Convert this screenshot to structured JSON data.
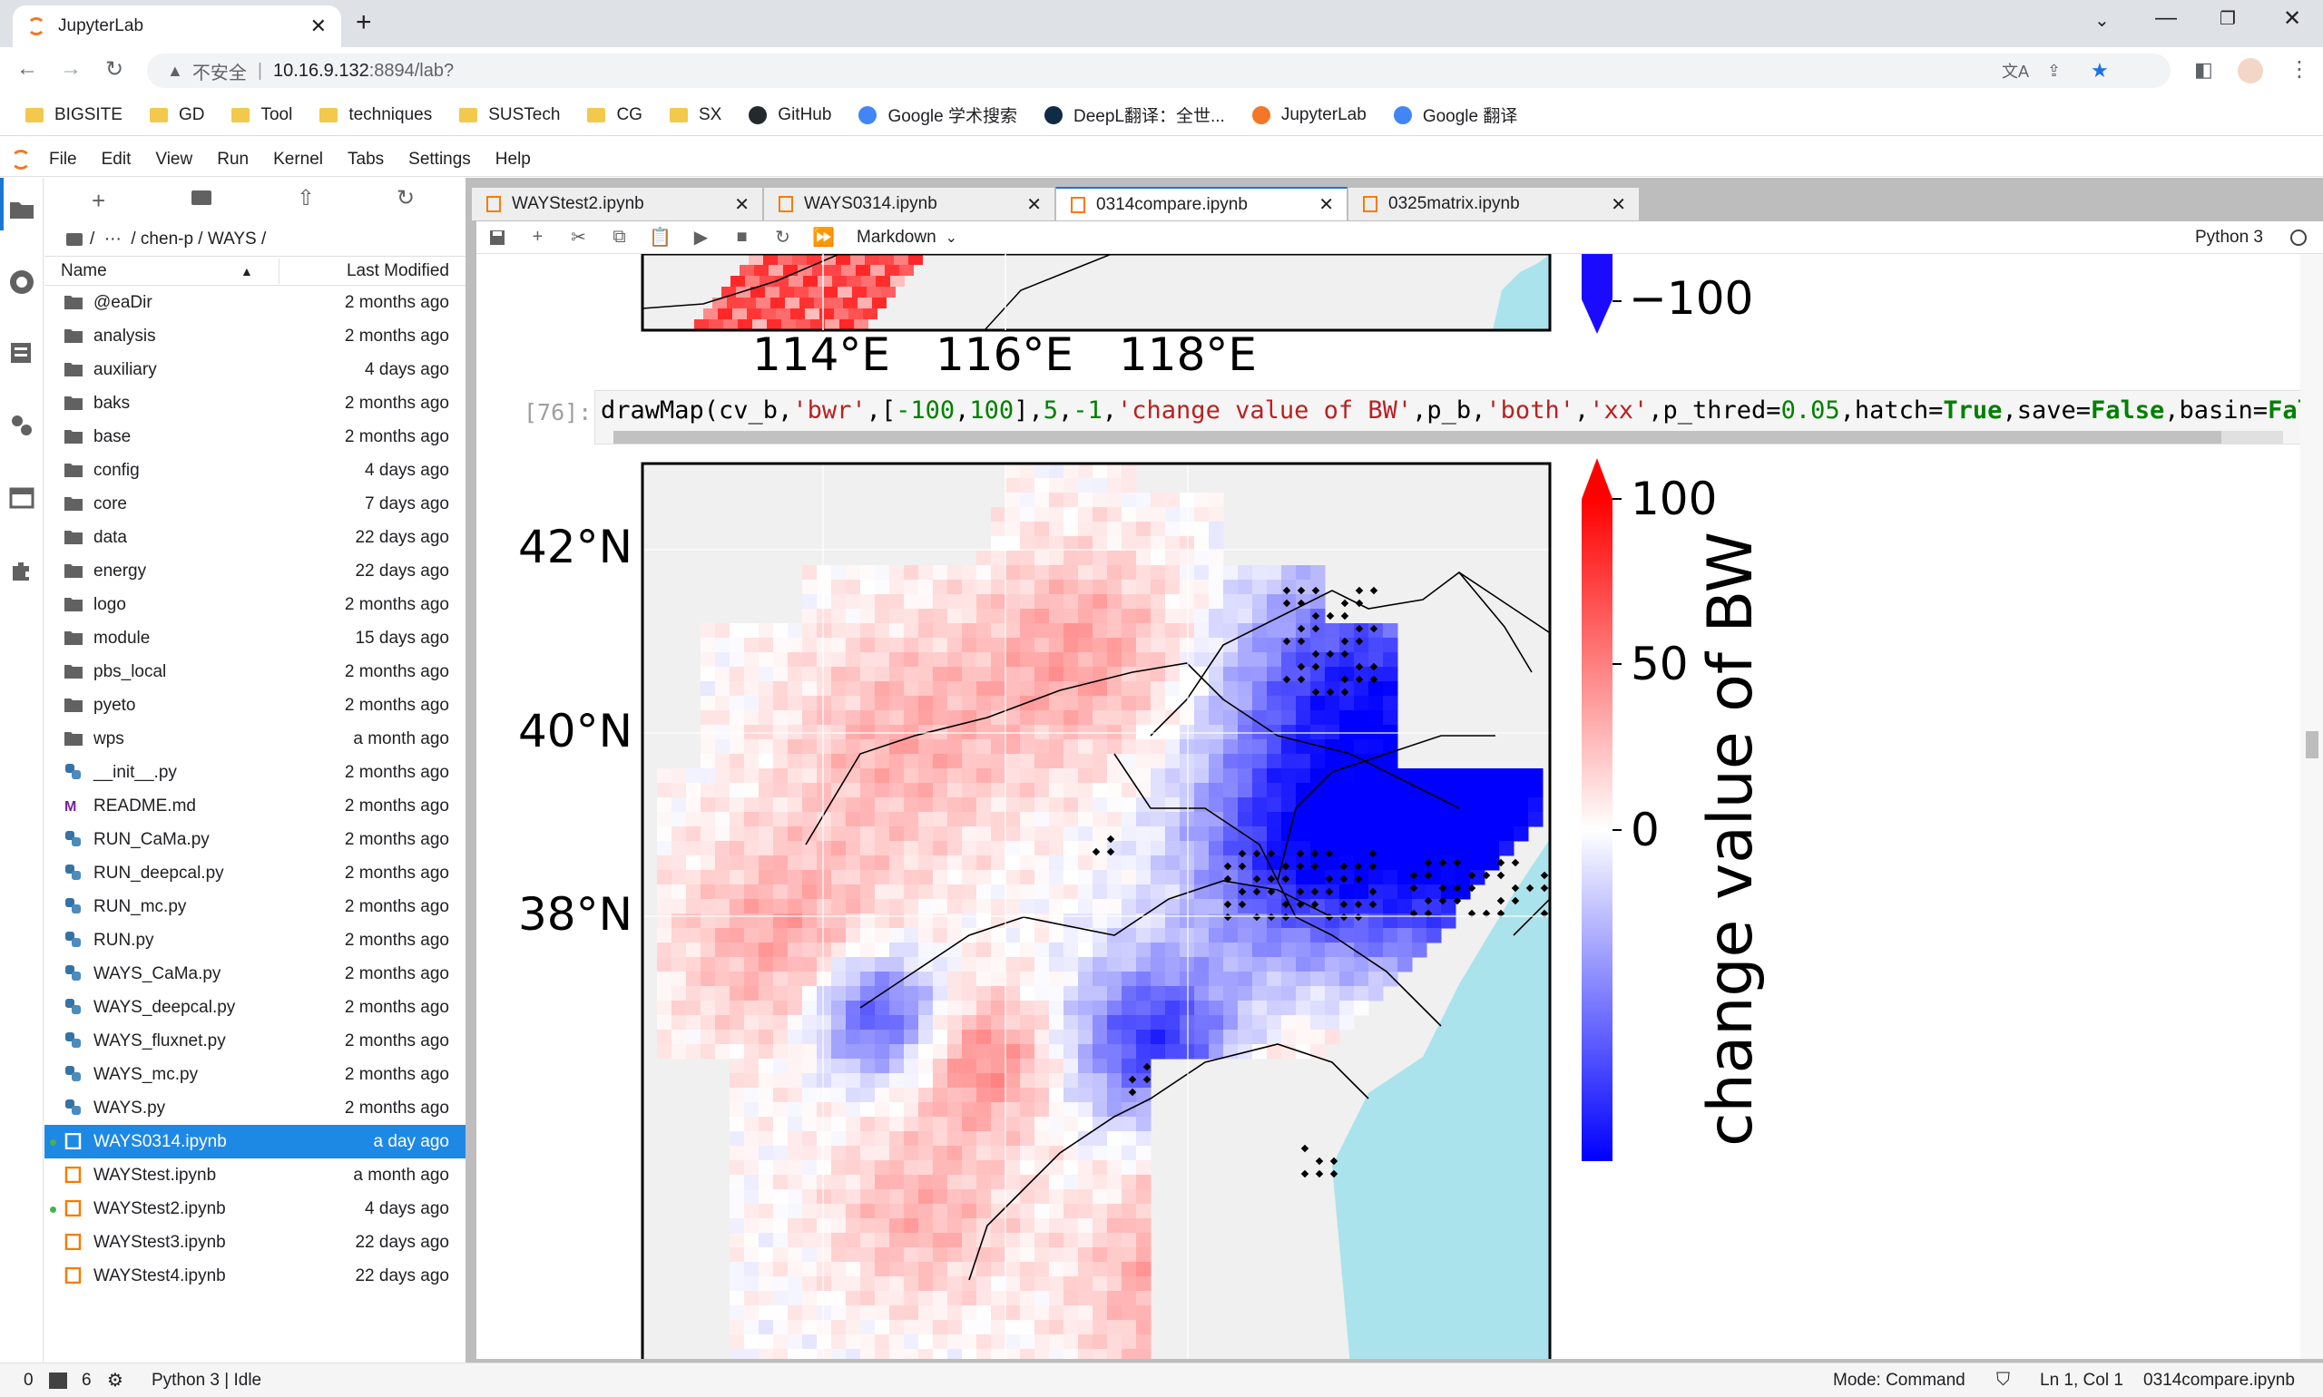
{
  "browser": {
    "tab_title": "JupyterLab",
    "security_label": "不安全",
    "url_host": "10.16.9.132",
    "url_path": ":8894/lab?",
    "bookmarks": [
      {
        "label": "BIGSITE",
        "icon": "folder"
      },
      {
        "label": "GD",
        "icon": "folder"
      },
      {
        "label": "Tool",
        "icon": "folder"
      },
      {
        "label": "techniques",
        "icon": "folder"
      },
      {
        "label": "SUSTech",
        "icon": "folder"
      },
      {
        "label": "CG",
        "icon": "folder"
      },
      {
        "label": "SX",
        "icon": "folder"
      },
      {
        "label": "GitHub",
        "icon": "github"
      },
      {
        "label": "Google 学术搜索",
        "icon": "scholar"
      },
      {
        "label": "DeepL翻译：全世...",
        "icon": "deepl"
      },
      {
        "label": "JupyterLab",
        "icon": "jupyter"
      },
      {
        "label": "Google 翻译",
        "icon": "translate"
      }
    ]
  },
  "menu": [
    "File",
    "Edit",
    "View",
    "Run",
    "Kernel",
    "Tabs",
    "Settings",
    "Help"
  ],
  "filebrowser": {
    "breadcrumb": "/  ···  / chen-p / WAYS /",
    "col_name": "Name",
    "col_modified": "Last Modified",
    "files": [
      {
        "name": "@eaDir",
        "modified": "2 months ago",
        "type": "folder"
      },
      {
        "name": "analysis",
        "modified": "2 months ago",
        "type": "folder"
      },
      {
        "name": "auxiliary",
        "modified": "4 days ago",
        "type": "folder"
      },
      {
        "name": "baks",
        "modified": "2 months ago",
        "type": "folder"
      },
      {
        "name": "base",
        "modified": "2 months ago",
        "type": "folder"
      },
      {
        "name": "config",
        "modified": "4 days ago",
        "type": "folder"
      },
      {
        "name": "core",
        "modified": "7 days ago",
        "type": "folder"
      },
      {
        "name": "data",
        "modified": "22 days ago",
        "type": "folder"
      },
      {
        "name": "energy",
        "modified": "22 days ago",
        "type": "folder"
      },
      {
        "name": "logo",
        "modified": "2 months ago",
        "type": "folder"
      },
      {
        "name": "module",
        "modified": "15 days ago",
        "type": "folder"
      },
      {
        "name": "pbs_local",
        "modified": "2 months ago",
        "type": "folder"
      },
      {
        "name": "pyeto",
        "modified": "2 months ago",
        "type": "folder"
      },
      {
        "name": "wps",
        "modified": "a month ago",
        "type": "folder"
      },
      {
        "name": "__init__.py",
        "modified": "2 months ago",
        "type": "python"
      },
      {
        "name": "README.md",
        "modified": "2 months ago",
        "type": "markdown"
      },
      {
        "name": "RUN_CaMa.py",
        "modified": "2 months ago",
        "type": "python"
      },
      {
        "name": "RUN_deepcal.py",
        "modified": "2 months ago",
        "type": "python"
      },
      {
        "name": "RUN_mc.py",
        "modified": "2 months ago",
        "type": "python"
      },
      {
        "name": "RUN.py",
        "modified": "2 months ago",
        "type": "python"
      },
      {
        "name": "WAYS_CaMa.py",
        "modified": "2 months ago",
        "type": "python"
      },
      {
        "name": "WAYS_deepcal.py",
        "modified": "2 months ago",
        "type": "python"
      },
      {
        "name": "WAYS_fluxnet.py",
        "modified": "2 months ago",
        "type": "python"
      },
      {
        "name": "WAYS_mc.py",
        "modified": "2 months ago",
        "type": "python"
      },
      {
        "name": "WAYS.py",
        "modified": "2 months ago",
        "type": "python"
      },
      {
        "name": "WAYS0314.ipynb",
        "modified": "a day ago",
        "type": "notebook",
        "selected": true,
        "running": true
      },
      {
        "name": "WAYStest.ipynb",
        "modified": "a month ago",
        "type": "notebook"
      },
      {
        "name": "WAYStest2.ipynb",
        "modified": "4 days ago",
        "type": "notebook",
        "running": true
      },
      {
        "name": "WAYStest3.ipynb",
        "modified": "22 days ago",
        "type": "notebook"
      },
      {
        "name": "WAYStest4.ipynb",
        "modified": "22 days ago",
        "type": "notebook"
      }
    ]
  },
  "doc_tabs": [
    {
      "label": "WAYStest2.ipynb",
      "active": false
    },
    {
      "label": "WAYS0314.ipynb",
      "active": false
    },
    {
      "label": "0314compare.ipynb",
      "active": true
    },
    {
      "label": "0325matrix.ipynb",
      "active": false
    }
  ],
  "nb_toolbar": {
    "cell_type": "Markdown",
    "kernel": "Python 3"
  },
  "cell": {
    "prompt": "[76]:",
    "code_tokens": [
      {
        "t": "drawMap(cv_b,",
        "c": "plain"
      },
      {
        "t": "'bwr'",
        "c": "str"
      },
      {
        "t": ",[",
        "c": "plain"
      },
      {
        "t": "-100",
        "c": "num"
      },
      {
        "t": ",",
        "c": "plain"
      },
      {
        "t": "100",
        "c": "num"
      },
      {
        "t": "],",
        "c": "plain"
      },
      {
        "t": "5",
        "c": "num"
      },
      {
        "t": ",",
        "c": "plain"
      },
      {
        "t": "-1",
        "c": "num"
      },
      {
        "t": ",",
        "c": "plain"
      },
      {
        "t": "'change value of BW'",
        "c": "str"
      },
      {
        "t": ",p_b,",
        "c": "plain"
      },
      {
        "t": "'both'",
        "c": "str"
      },
      {
        "t": ",",
        "c": "plain"
      },
      {
        "t": "'xx'",
        "c": "str"
      },
      {
        "t": ",p_thred=",
        "c": "plain"
      },
      {
        "t": "0.05",
        "c": "num"
      },
      {
        "t": ",hatch=",
        "c": "plain"
      },
      {
        "t": "True",
        "c": "kw"
      },
      {
        "t": ",save=",
        "c": "plain"
      },
      {
        "t": "False",
        "c": "kw"
      },
      {
        "t": ",basin=",
        "c": "plain"
      },
      {
        "t": "False",
        "c": "kw"
      }
    ]
  },
  "prev_output": {
    "lon_ticks": [
      "114°E",
      "116°E",
      "118°E"
    ],
    "colorbar_tick": "−100"
  },
  "map": {
    "lat_ticks": [
      "42°N",
      "40°N",
      "38°N"
    ],
    "colorbar_ticks": [
      "100",
      "50",
      "0"
    ],
    "colorbar_label": "change value of BW",
    "colors": {
      "ocean": "#aae3ec",
      "background": "#f0f0f0",
      "neg": "#1a0bff",
      "pos": "#ff1a1a"
    }
  },
  "status": {
    "terminals": "0",
    "kernels": "6",
    "kernel_state": "Python 3 | Idle",
    "mode": "Mode: Command",
    "cursor": "Ln 1, Col 1",
    "file": "0314compare.ipynb"
  }
}
